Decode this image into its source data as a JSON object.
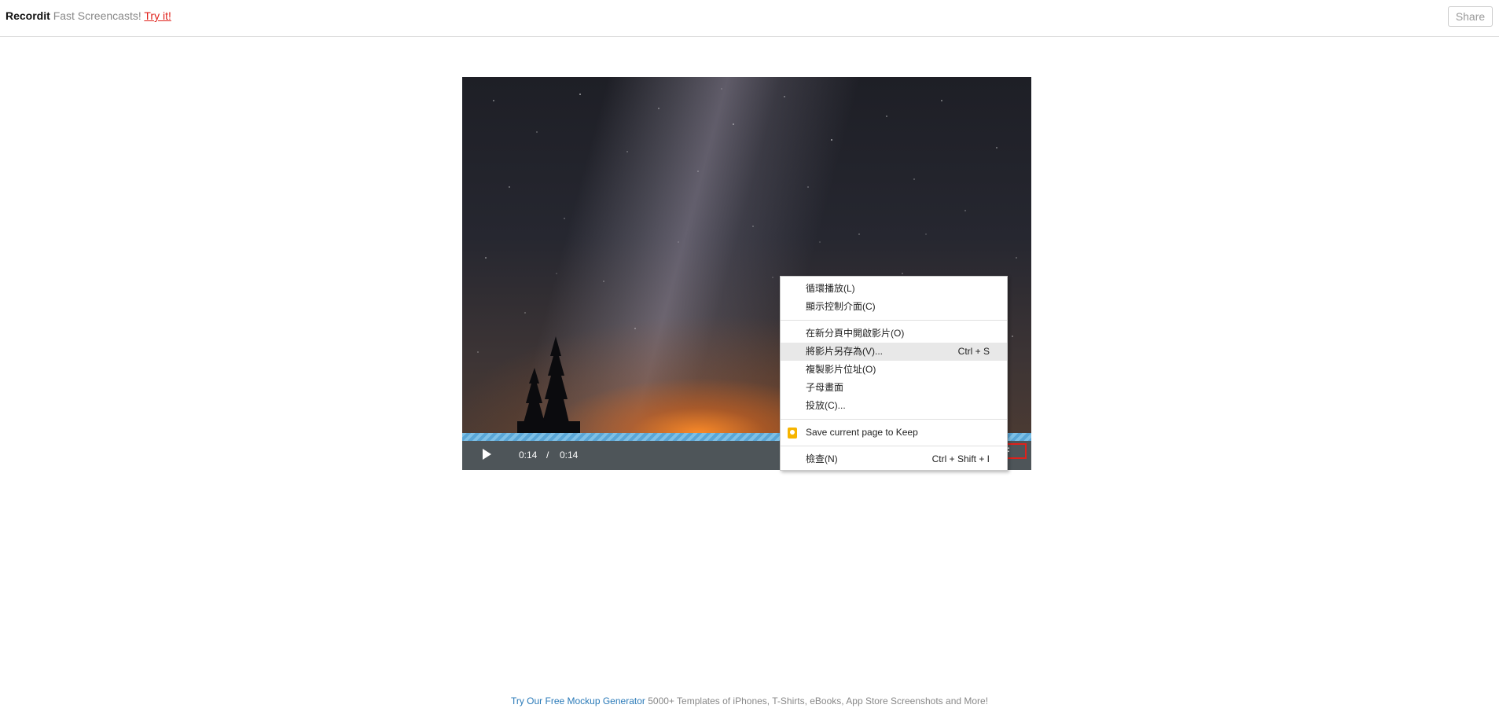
{
  "header": {
    "brand_name": "Recordit",
    "tagline": "Fast Screencasts!",
    "try_link": "Try it!",
    "share_label": "Share"
  },
  "player": {
    "current_time": "0:14",
    "separator": "/",
    "duration": "0:14",
    "gif_label": "F",
    "progress": 1.0
  },
  "context_menu": {
    "items": [
      {
        "label": "循環播放(L)",
        "shortcut": ""
      },
      {
        "label": "顯示控制介面(C)",
        "shortcut": ""
      },
      {
        "label": "在新分頁中開啟影片(O)",
        "shortcut": ""
      },
      {
        "label": "將影片另存為(V)...",
        "shortcut": "Ctrl + S"
      },
      {
        "label": "複製影片位址(O)",
        "shortcut": ""
      },
      {
        "label": "子母畫面",
        "shortcut": ""
      },
      {
        "label": "投放(C)...",
        "shortcut": ""
      },
      {
        "label": "Save current page to Keep",
        "shortcut": ""
      },
      {
        "label": "檢查(N)",
        "shortcut": "Ctrl + Shift + I"
      }
    ],
    "highlighted_index": 3
  },
  "footer": {
    "link_text": "Try Our Free Mockup Generator",
    "description": "5000+ Templates of iPhones, T-Shirts, eBooks, App Store Screenshots and More!"
  },
  "colors": {
    "accent_red": "#e0211b",
    "link_blue": "#2a7ab8",
    "progress_blue": "#7ec0e6",
    "keep_yellow": "#f6b400"
  }
}
